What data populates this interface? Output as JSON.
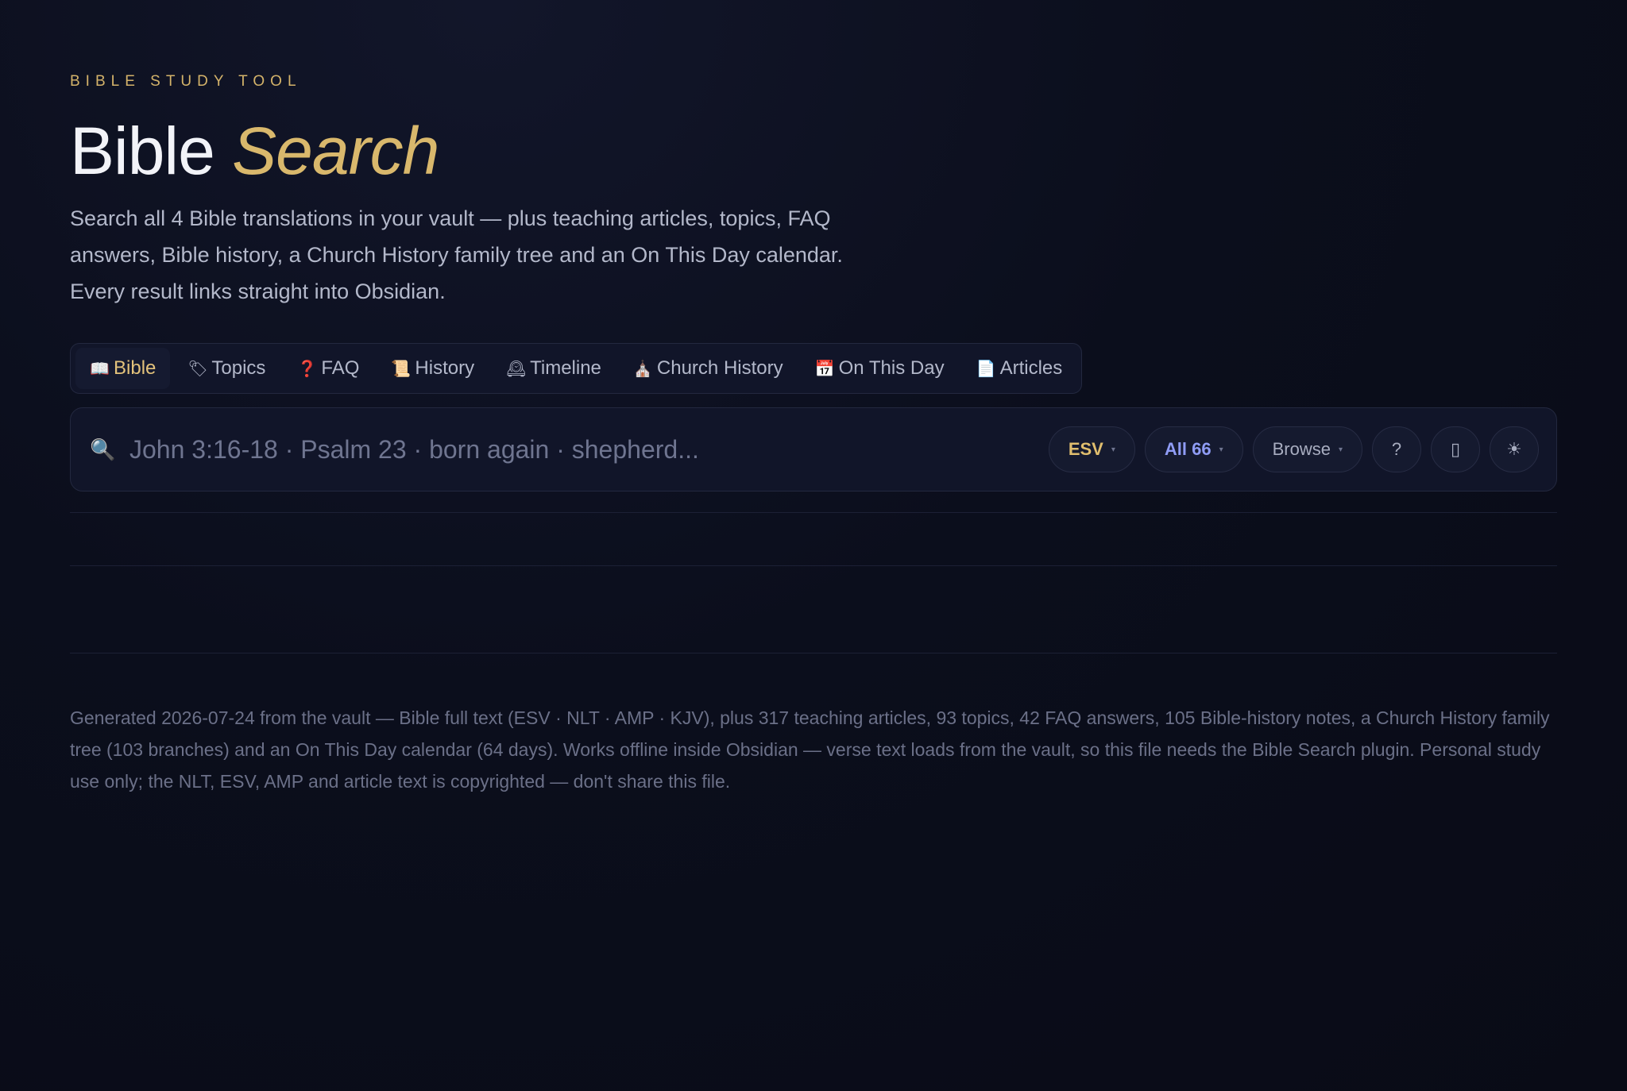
{
  "header": {
    "eyebrow": "BIBLE STUDY TOOL",
    "title_main": "Bible",
    "title_accent": "Search",
    "intro": "Search all 4 Bible translations in your vault — plus teaching articles, topics, FAQ answers, Bible history, a Church History family tree and an On This Day calendar. Every result links straight into Obsidian."
  },
  "tabs": [
    {
      "icon": "📖",
      "icon_name": "open-book-icon",
      "label": "Bible",
      "active": true
    },
    {
      "icon": "🏷",
      "icon_name": "label-tag-icon",
      "label": "Topics"
    },
    {
      "icon": "❓",
      "icon_name": "question-mark-icon",
      "label": "FAQ"
    },
    {
      "icon": "📜",
      "icon_name": "scroll-icon",
      "label": "History"
    },
    {
      "icon": "🕰",
      "icon_name": "clock-icon",
      "label": "Timeline"
    },
    {
      "icon": "⛪",
      "icon_name": "church-icon",
      "label": "Church History"
    },
    {
      "icon": "📅",
      "icon_name": "calendar-icon",
      "label": "On This Day"
    },
    {
      "icon": "📄",
      "icon_name": "document-icon",
      "label": "Articles"
    }
  ],
  "search": {
    "placeholder": "John 3:16-18 · Psalm 23 · born again · shepherd...",
    "value": "",
    "icon": "🔍",
    "translation": "ESV",
    "scope": "All 66",
    "browse": "Browse",
    "help": "?",
    "caret": "▾",
    "layout_glyph": "▯",
    "theme_glyph": "☀"
  },
  "colors": {
    "accent_gold": "#d9b86c",
    "accent_indigo": "#8f9cf5",
    "background": "#0a0d1a"
  },
  "footer": {
    "text": "Generated 2026-07-24 from the vault — Bible full text (ESV · NLT · AMP · KJV), plus 317 teaching articles, 93 topics, 42 FAQ answers, 105 Bible-history notes, a Church History family tree (103 branches) and an On This Day calendar (64 days). Works offline inside Obsidian — verse text loads from the vault, so this file needs the Bible Search plugin. Personal study use only; the NLT, ESV, AMP and article text is copyrighted — don't share this file."
  }
}
